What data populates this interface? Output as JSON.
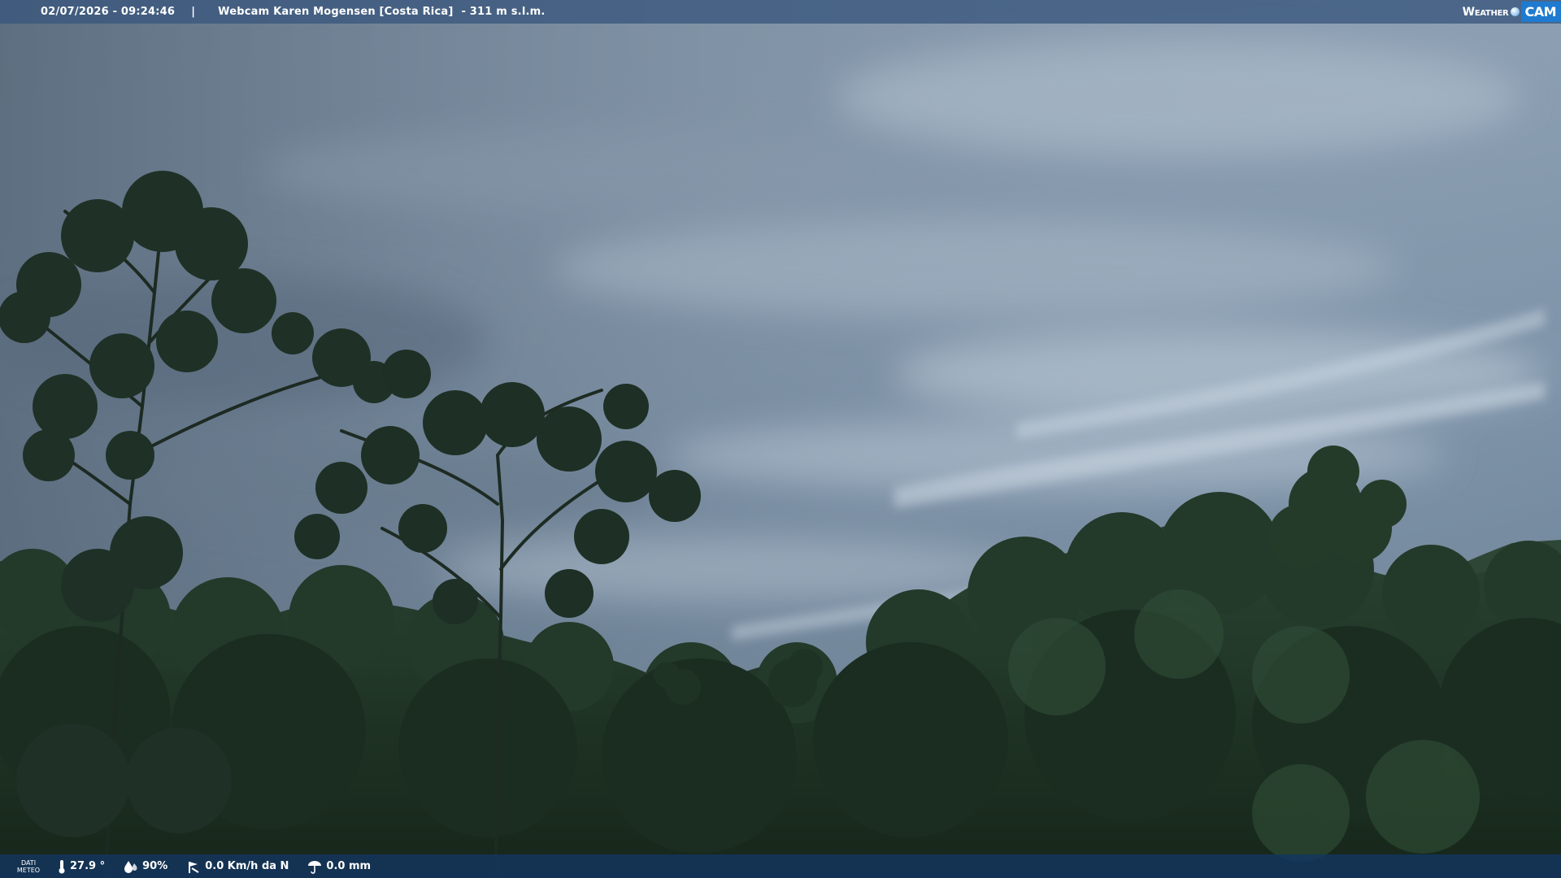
{
  "header": {
    "datetime": "02/07/2026 - 09:24:46",
    "separator": "|",
    "camera_name": "Webcam Karen Mogensen [Costa Rica]",
    "altitude": "- 311 m s.l.m."
  },
  "logo": {
    "weather": "Weather",
    "cam": "CAM",
    "accent_color": "#1e7bd0"
  },
  "footer": {
    "label_line1": "DATI",
    "label_line2": "METEO",
    "temperature": "27.9 °",
    "humidity": "90%",
    "wind": "0.0 Km/h da N",
    "rain": "0.0 mm",
    "icons": [
      "thermometer-icon",
      "humidity-icon",
      "wind-icon",
      "rain-icon"
    ]
  },
  "colors": {
    "top_bar": "#38567c",
    "bottom_bar": "#143660",
    "sky": "#8ea3b6",
    "foliage": "#1e3322"
  }
}
